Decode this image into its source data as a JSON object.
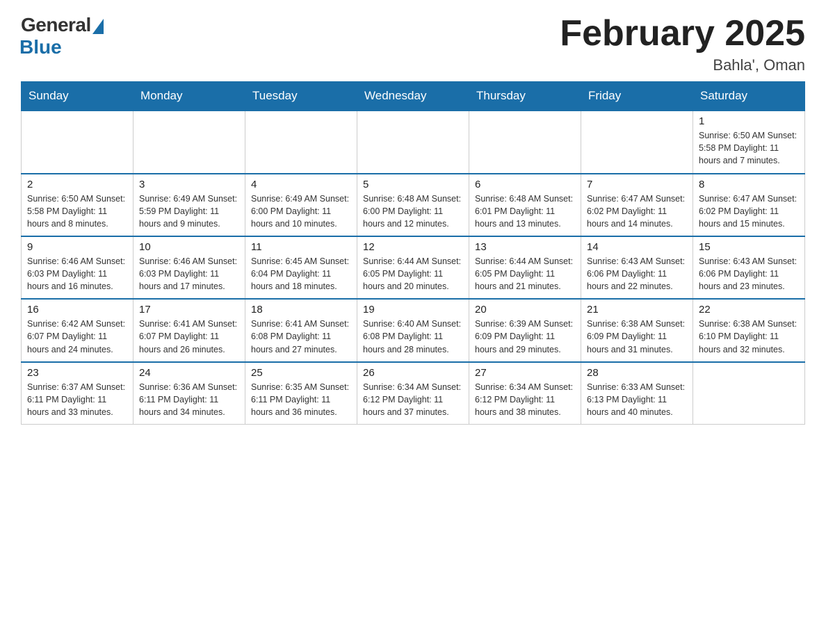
{
  "header": {
    "logo_general": "General",
    "logo_blue": "Blue",
    "month_title": "February 2025",
    "location": "Bahla', Oman"
  },
  "weekdays": [
    "Sunday",
    "Monday",
    "Tuesday",
    "Wednesday",
    "Thursday",
    "Friday",
    "Saturday"
  ],
  "weeks": [
    [
      {
        "day": "",
        "info": ""
      },
      {
        "day": "",
        "info": ""
      },
      {
        "day": "",
        "info": ""
      },
      {
        "day": "",
        "info": ""
      },
      {
        "day": "",
        "info": ""
      },
      {
        "day": "",
        "info": ""
      },
      {
        "day": "1",
        "info": "Sunrise: 6:50 AM\nSunset: 5:58 PM\nDaylight: 11 hours and 7 minutes."
      }
    ],
    [
      {
        "day": "2",
        "info": "Sunrise: 6:50 AM\nSunset: 5:58 PM\nDaylight: 11 hours and 8 minutes."
      },
      {
        "day": "3",
        "info": "Sunrise: 6:49 AM\nSunset: 5:59 PM\nDaylight: 11 hours and 9 minutes."
      },
      {
        "day": "4",
        "info": "Sunrise: 6:49 AM\nSunset: 6:00 PM\nDaylight: 11 hours and 10 minutes."
      },
      {
        "day": "5",
        "info": "Sunrise: 6:48 AM\nSunset: 6:00 PM\nDaylight: 11 hours and 12 minutes."
      },
      {
        "day": "6",
        "info": "Sunrise: 6:48 AM\nSunset: 6:01 PM\nDaylight: 11 hours and 13 minutes."
      },
      {
        "day": "7",
        "info": "Sunrise: 6:47 AM\nSunset: 6:02 PM\nDaylight: 11 hours and 14 minutes."
      },
      {
        "day": "8",
        "info": "Sunrise: 6:47 AM\nSunset: 6:02 PM\nDaylight: 11 hours and 15 minutes."
      }
    ],
    [
      {
        "day": "9",
        "info": "Sunrise: 6:46 AM\nSunset: 6:03 PM\nDaylight: 11 hours and 16 minutes."
      },
      {
        "day": "10",
        "info": "Sunrise: 6:46 AM\nSunset: 6:03 PM\nDaylight: 11 hours and 17 minutes."
      },
      {
        "day": "11",
        "info": "Sunrise: 6:45 AM\nSunset: 6:04 PM\nDaylight: 11 hours and 18 minutes."
      },
      {
        "day": "12",
        "info": "Sunrise: 6:44 AM\nSunset: 6:05 PM\nDaylight: 11 hours and 20 minutes."
      },
      {
        "day": "13",
        "info": "Sunrise: 6:44 AM\nSunset: 6:05 PM\nDaylight: 11 hours and 21 minutes."
      },
      {
        "day": "14",
        "info": "Sunrise: 6:43 AM\nSunset: 6:06 PM\nDaylight: 11 hours and 22 minutes."
      },
      {
        "day": "15",
        "info": "Sunrise: 6:43 AM\nSunset: 6:06 PM\nDaylight: 11 hours and 23 minutes."
      }
    ],
    [
      {
        "day": "16",
        "info": "Sunrise: 6:42 AM\nSunset: 6:07 PM\nDaylight: 11 hours and 24 minutes."
      },
      {
        "day": "17",
        "info": "Sunrise: 6:41 AM\nSunset: 6:07 PM\nDaylight: 11 hours and 26 minutes."
      },
      {
        "day": "18",
        "info": "Sunrise: 6:41 AM\nSunset: 6:08 PM\nDaylight: 11 hours and 27 minutes."
      },
      {
        "day": "19",
        "info": "Sunrise: 6:40 AM\nSunset: 6:08 PM\nDaylight: 11 hours and 28 minutes."
      },
      {
        "day": "20",
        "info": "Sunrise: 6:39 AM\nSunset: 6:09 PM\nDaylight: 11 hours and 29 minutes."
      },
      {
        "day": "21",
        "info": "Sunrise: 6:38 AM\nSunset: 6:09 PM\nDaylight: 11 hours and 31 minutes."
      },
      {
        "day": "22",
        "info": "Sunrise: 6:38 AM\nSunset: 6:10 PM\nDaylight: 11 hours and 32 minutes."
      }
    ],
    [
      {
        "day": "23",
        "info": "Sunrise: 6:37 AM\nSunset: 6:11 PM\nDaylight: 11 hours and 33 minutes."
      },
      {
        "day": "24",
        "info": "Sunrise: 6:36 AM\nSunset: 6:11 PM\nDaylight: 11 hours and 34 minutes."
      },
      {
        "day": "25",
        "info": "Sunrise: 6:35 AM\nSunset: 6:11 PM\nDaylight: 11 hours and 36 minutes."
      },
      {
        "day": "26",
        "info": "Sunrise: 6:34 AM\nSunset: 6:12 PM\nDaylight: 11 hours and 37 minutes."
      },
      {
        "day": "27",
        "info": "Sunrise: 6:34 AM\nSunset: 6:12 PM\nDaylight: 11 hours and 38 minutes."
      },
      {
        "day": "28",
        "info": "Sunrise: 6:33 AM\nSunset: 6:13 PM\nDaylight: 11 hours and 40 minutes."
      },
      {
        "day": "",
        "info": ""
      }
    ]
  ]
}
